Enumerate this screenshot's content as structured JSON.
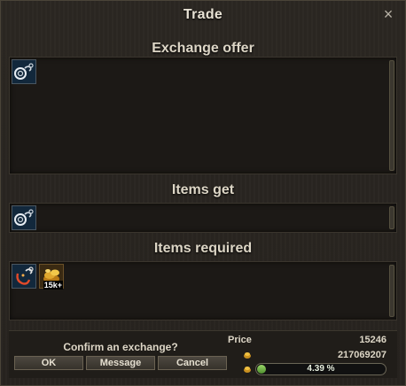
{
  "window": {
    "title": "Trade",
    "close_glyph": "×"
  },
  "exchange_offer": {
    "heading": "Exchange offer",
    "items": [
      {
        "icon": "lock-chain-item-icon"
      }
    ]
  },
  "items_get": {
    "heading": "Items get",
    "items": [
      {
        "icon": "lock-chain-item-icon"
      }
    ]
  },
  "items_required": {
    "heading": "Items required",
    "items": [
      {
        "icon": "chain-hook-item-icon"
      },
      {
        "icon": "gold-coins-item-icon",
        "stack": "15k+"
      }
    ]
  },
  "footer": {
    "confirm_text": "Confirm an exchange?",
    "buttons": {
      "ok": "OK",
      "message": "Message",
      "cancel": "Cancel"
    },
    "price_label": "Price",
    "price_value": "15246",
    "money_value": "217069207",
    "progress_text": "4.39 %",
    "progress_fraction": 0.0439
  },
  "colors": {
    "accent_green": "#7ac24a",
    "gold": "#e0a82e",
    "text": "#ddd6c6"
  }
}
